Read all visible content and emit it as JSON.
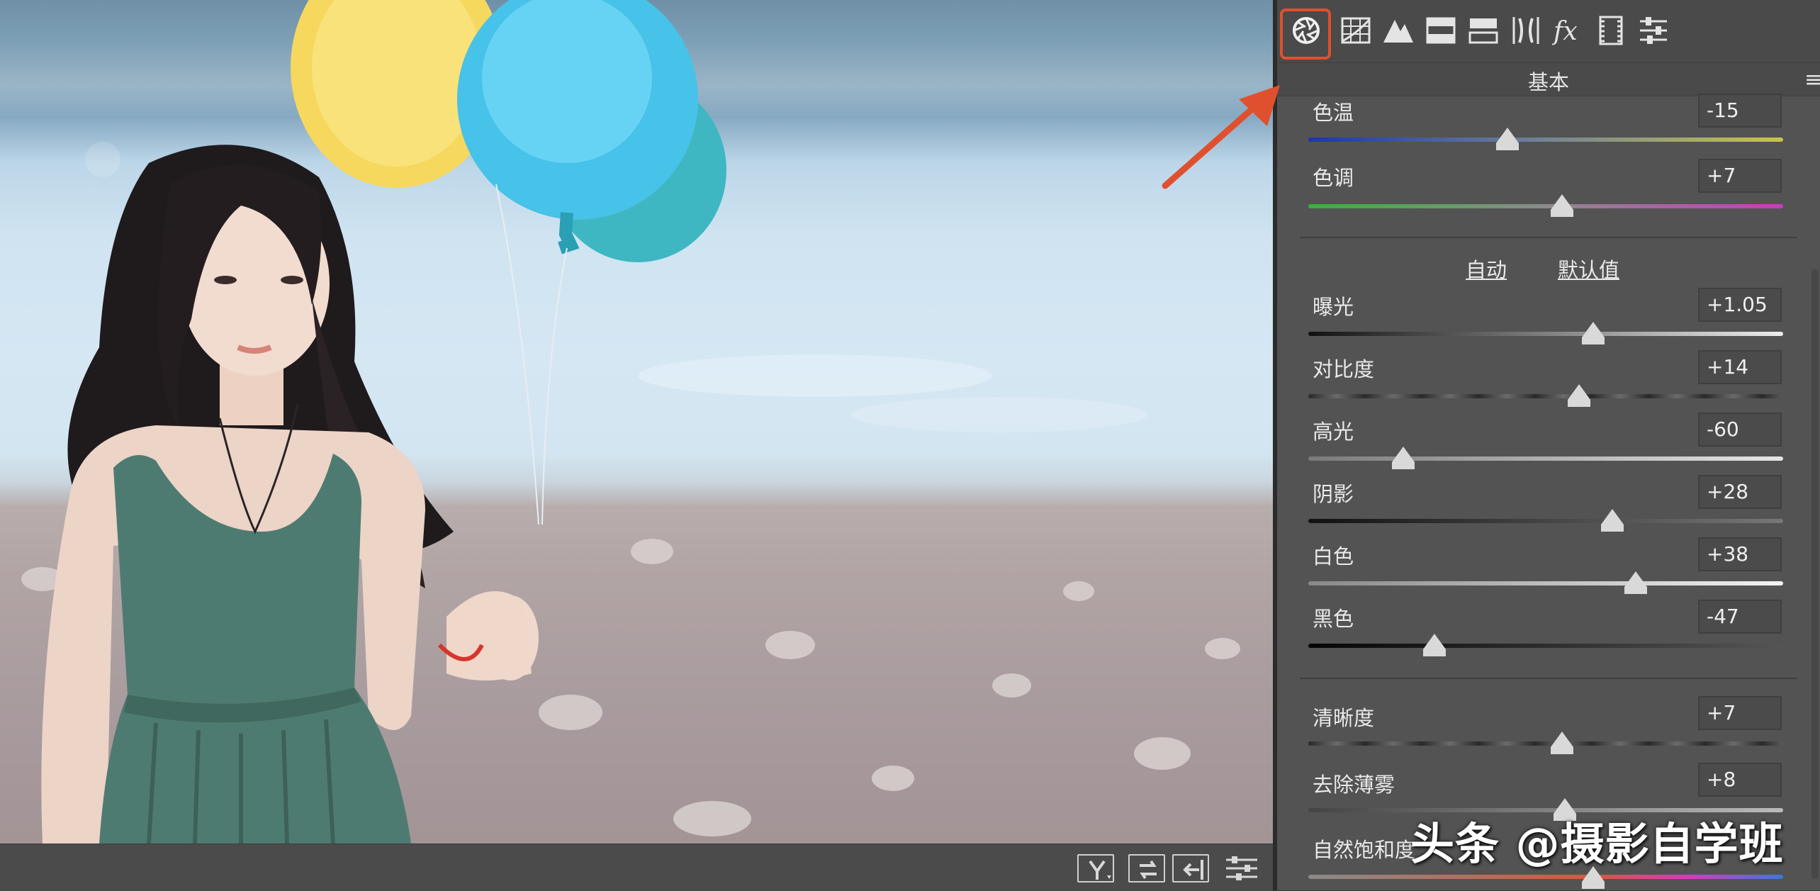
{
  "toolbar": {
    "icons": [
      "aperture-icon",
      "grid-curve-icon",
      "mountains-icon",
      "hsl-icon",
      "split-toning-icon",
      "lens-icon",
      "fx-icon",
      "film-strip-icon",
      "sliders-icon"
    ],
    "selected": "aperture-icon",
    "highlight_color": "#e0502e"
  },
  "section": {
    "title": "基本"
  },
  "white_balance": [
    {
      "label": "色温",
      "value": "-15",
      "level": 0.42
    },
    {
      "label": "色调",
      "value": "+7",
      "level": 0.535
    }
  ],
  "tone_links": {
    "auto": "自动",
    "default": "默认值"
  },
  "tone": [
    {
      "label": "曝光",
      "value": "+1.05",
      "level": 0.6
    },
    {
      "label": "对比度",
      "value": "+14",
      "level": 0.57
    },
    {
      "label": "高光",
      "value": "-60",
      "level": 0.2
    },
    {
      "label": "阴影",
      "value": "+28",
      "level": 0.64
    },
    {
      "label": "白色",
      "value": "+38",
      "level": 0.69
    },
    {
      "label": "黑色",
      "value": "-47",
      "level": 0.265
    }
  ],
  "presence": [
    {
      "label": "清晰度",
      "value": "+7",
      "level": 0.535
    },
    {
      "label": "去除薄雾",
      "value": "+8",
      "level": 0.54
    },
    {
      "label": "自然饱和度",
      "value": "",
      "level": 0.6
    }
  ],
  "watermark": "头条 @摄影自学班",
  "bottom_bar": {
    "buttons": [
      "before-after-y-icon",
      "swap-icon",
      "copy-settings-icon",
      "settings-icon"
    ]
  }
}
